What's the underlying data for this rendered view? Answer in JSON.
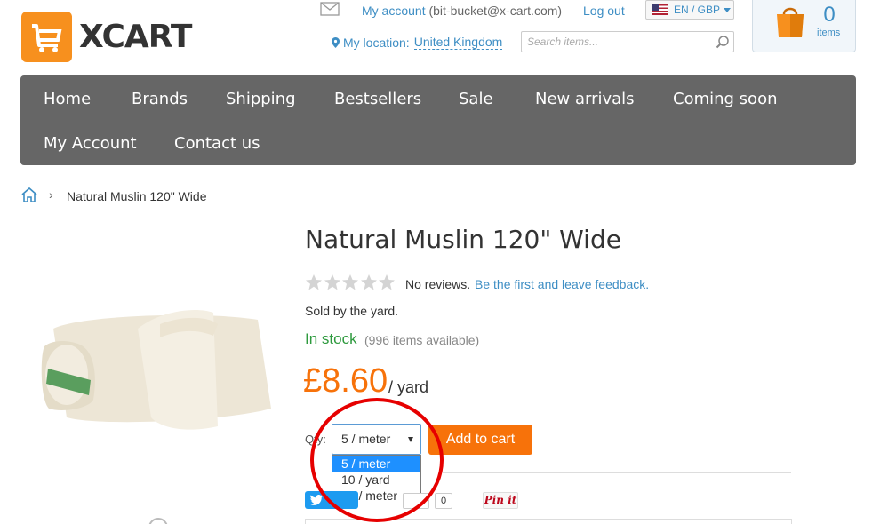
{
  "header": {
    "logo_text": "XCART",
    "account_label": "My account",
    "account_email": "(bit-bucket@x-cart.com)",
    "logout_label": "Log out",
    "language_currency": "EN / GBP",
    "location_label": "My location:",
    "location_value": "United Kingdom",
    "search_placeholder": "Search items...",
    "cart_count": "0",
    "cart_items_label": "items"
  },
  "nav": {
    "items": [
      "Home",
      "Brands",
      "Shipping",
      "Bestsellers",
      "Sale",
      "New arrivals",
      "Coming soon",
      "My Account",
      "Contact us"
    ]
  },
  "breadcrumb": {
    "separator": "›",
    "current": "Natural Muslin 120\" Wide"
  },
  "product": {
    "title": "Natural Muslin 120\" Wide",
    "rating": 0,
    "rating_max": 5,
    "no_reviews": "No reviews.",
    "feedback_link": "Be the first and leave feedback.",
    "sold_by": "Sold by the yard.",
    "stock_status": "In stock",
    "stock_available": "(996 items available)",
    "price": "£8.60",
    "price_unit": "/ yard",
    "qty_label": "Qty:",
    "qty_selected": "5 / meter",
    "qty_options": [
      "5 / meter",
      "10 / yard",
      "10 / meter"
    ],
    "add_to_cart": "Add to cart"
  },
  "social": {
    "facebook_count": "0",
    "pinit_label": "Pin it"
  },
  "colors": {
    "accent_orange": "#f7720a",
    "link_blue": "#3e8ec4",
    "nav_bg": "#666666",
    "stock_green": "#2e9a3e",
    "annotation_red": "#e60000"
  }
}
